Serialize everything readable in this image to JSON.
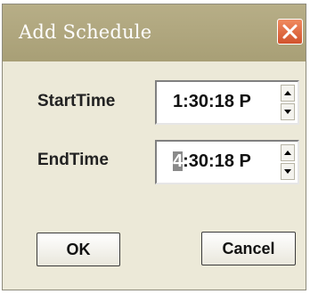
{
  "window": {
    "title": "Add Schedule"
  },
  "fields": {
    "start": {
      "label": "StartTime",
      "value_pre": "",
      "value_sel": "",
      "value_post": "1:30:18 P"
    },
    "end": {
      "label": "EndTime",
      "value_pre": "",
      "value_sel": "4",
      "value_post": ":30:18 P"
    }
  },
  "buttons": {
    "ok": "OK",
    "cancel": "Cancel"
  },
  "colors": {
    "titlebar": "#b1a881",
    "dialog_bg": "#ece9d8",
    "close_button": "#e06a44",
    "selection": "#8a8a8a"
  },
  "icons": {
    "close": "close-icon",
    "spin_up": "spin-up-icon",
    "spin_down": "spin-down-icon"
  }
}
